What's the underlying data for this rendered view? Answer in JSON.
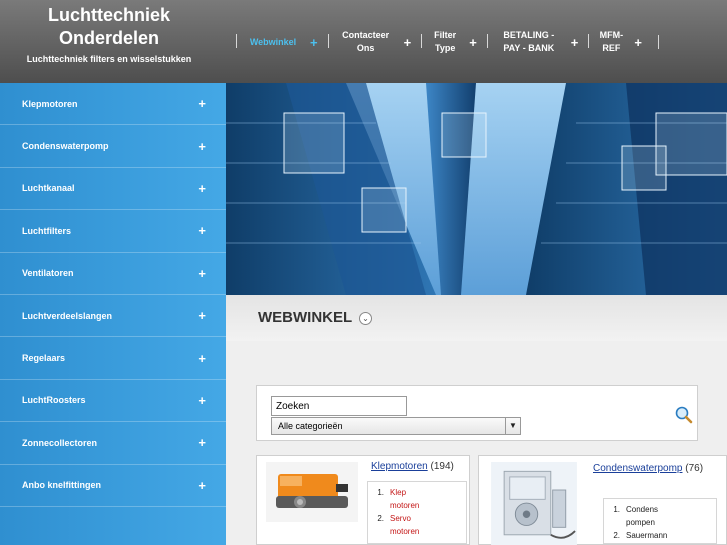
{
  "site": {
    "title": "Luchttechniek Onderdelen",
    "subtitle": "Luchttechniek filters en wisselstukken"
  },
  "nav": [
    {
      "label": "Webwinkel",
      "active": true
    },
    {
      "label": "Contacteer Ons",
      "active": false
    },
    {
      "label": "Filter Type",
      "active": false
    },
    {
      "label": "BETALING - PAY - BANK",
      "active": false
    },
    {
      "label": "MFM-REF",
      "active": false
    }
  ],
  "nav_plus": "+",
  "sidebar": {
    "items": [
      {
        "label": "Klepmotoren"
      },
      {
        "label": "Condenswaterpomp"
      },
      {
        "label": "Luchtkanaal"
      },
      {
        "label": "Luchtfilters"
      },
      {
        "label": "Ventilatoren"
      },
      {
        "label": "Luchtverdeelslangen"
      },
      {
        "label": "Regelaars"
      },
      {
        "label": "LuchtRoosters"
      },
      {
        "label": "Zonnecollectoren"
      },
      {
        "label": "Anbo knelfittingen"
      }
    ],
    "plus": "+"
  },
  "main": {
    "title": "WEBWINKEL",
    "toggle_icon": "chevron-down-icon"
  },
  "search": {
    "input_value": "Zoeken",
    "category_value": "Alle categorieën",
    "icon": "magnifier-icon"
  },
  "products": [
    {
      "name": "Klepmotoren",
      "count": "(194)",
      "subcategories": [
        {
          "num": "1.",
          "label": "Klep motoren"
        },
        {
          "num": "2.",
          "label": "Servo motoren"
        }
      ]
    },
    {
      "name": "Condenswaterpomp",
      "count": "(76)",
      "subcategories": [
        {
          "num": "1.",
          "label": "Condens pompen"
        },
        {
          "num": "2.",
          "label": "Sauermann"
        }
      ]
    }
  ],
  "colors": {
    "accent": "#4cc0ee",
    "sidebar": "#3a9edd",
    "header": "#5e5e5e",
    "link": "#1a3f9a",
    "subcategory": "#c41717"
  }
}
